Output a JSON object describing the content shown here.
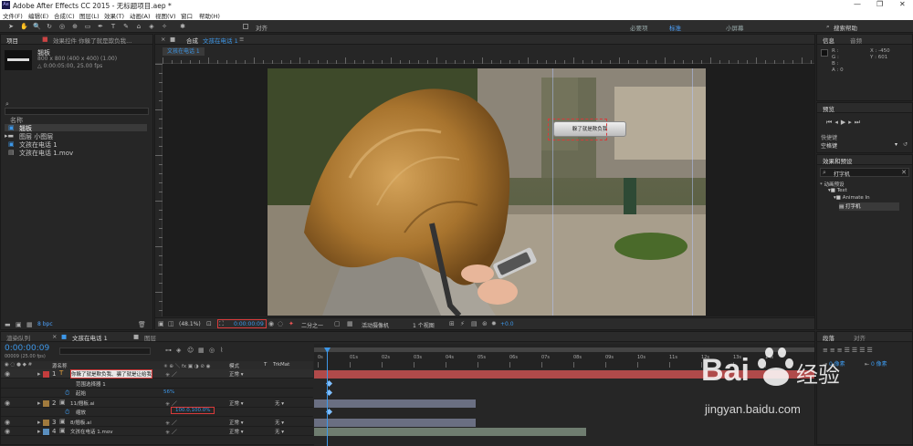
{
  "app": {
    "title": "Adobe After Effects CC 2015 - 无标题项目.aep *",
    "logo": "Ae"
  },
  "menu": [
    "文件(F)",
    "编辑(E)",
    "合成(C)",
    "图层(L)",
    "效果(T)",
    "动画(A)",
    "视图(V)",
    "窗口",
    "帮助(H)"
  ],
  "toolbar": {
    "snap_label": "对齐",
    "workspaces": [
      "必要项",
      "标准",
      "小屏幕"
    ],
    "search_label": "搜索帮助"
  },
  "project": {
    "tab": "项目",
    "tab2": "效果控件 你躲了就是欺负我...",
    "selected_name": "翘板",
    "selected_info": "800 x 800  (400 x 400) (1.00)",
    "selected_dur": "△ 0:00:05:00, 25.00 fps",
    "col_name": "名称",
    "items": [
      "翘板",
      "图层 小图层",
      "文孩在电话 1",
      "文孩在电话 1.mov"
    ],
    "bpc": "8 bpc"
  },
  "comp": {
    "tab_prefix": "合成",
    "tab_name": "文孩在电话 1",
    "flow_tab": "文孩在电话 1",
    "zoom": "(48.1%)",
    "time": "0:00:00:09",
    "res": "二分之一",
    "camera": "活动摄像机",
    "views": "1 个视图",
    "exposure": "+0.0",
    "overlay_text": "躲了就是欺负我"
  },
  "info": {
    "tab": "信息",
    "tab2": "音频",
    "r": "R :",
    "g": "G :",
    "b": "B :",
    "a": "A : 0",
    "x": "X : -450",
    "y": "Y : 601"
  },
  "preview": {
    "tab": "预览",
    "shortcut_label": "快捷键",
    "shortcut_value": "空格键"
  },
  "effects": {
    "tab": "效果和预设",
    "search": "打字机",
    "tree": [
      "* 动画预设",
      "Text",
      "Animate In",
      "打字机"
    ]
  },
  "timeline": {
    "tab_render": "渲染队列",
    "tab_comp": "文孩在电话 1",
    "tab_other": "图层",
    "timecode": "0:00:00:09",
    "fps": "00009 (25.00 fps)",
    "col_source": "源名称",
    "col_mode": "模式",
    "col_t": "T",
    "col_trkmat": "TrkMat",
    "layers": [
      {
        "num": "1",
        "name": "你躲了就是欺负我、骗了就是让给我",
        "mode": "正常",
        "trk": "",
        "color": "#c43d3d"
      },
      {
        "num": "",
        "name": "范围选择器 1",
        "mode": "",
        "trk": "",
        "color": ""
      },
      {
        "num": "",
        "name": "起始",
        "mode": "",
        "trk": "",
        "value": "56%",
        "color": ""
      },
      {
        "num": "2",
        "name": "11/翘板.ai",
        "mode": "正常",
        "trk": "无",
        "color": "#a07a3d"
      },
      {
        "num": "",
        "name": "缩放",
        "mode": "",
        "trk": "",
        "value": "100.0,100.0%",
        "color": ""
      },
      {
        "num": "3",
        "name": "8/翘板.ai",
        "mode": "正常",
        "trk": "无",
        "color": "#a07a3d"
      },
      {
        "num": "4",
        "name": "文孩在电话 1.mov",
        "mode": "正常",
        "trk": "无",
        "color": "#5a8fbf"
      }
    ],
    "ticks": [
      "0s",
      "01s",
      "02s",
      "03s",
      "04s",
      "05s",
      "06s",
      "07s",
      "08s",
      "09s",
      "10s",
      "11s",
      "12s",
      "13s",
      "14s"
    ]
  },
  "para": {
    "tab": "段落",
    "tab2": "对齐"
  },
  "watermark": {
    "brand": "Bai",
    "brand2": "du",
    "brand_cn": "经验",
    "url": "jingyan.baidu.com"
  }
}
